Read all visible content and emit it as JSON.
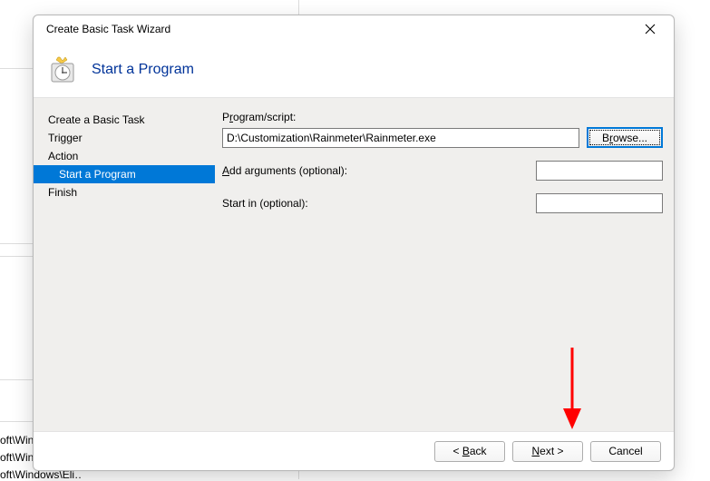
{
  "background": {
    "frag1": "oft\\Wind…",
    "frag2": "oft\\Windows\\U…",
    "frag3": "oft\\Windows\\Eli…"
  },
  "dialog": {
    "title": "Create Basic Task Wizard",
    "header": "Start a Program",
    "sidebar": {
      "items": [
        {
          "label": "Create a Basic Task"
        },
        {
          "label": "Trigger"
        },
        {
          "label": "Action"
        },
        {
          "label": "Start a Program"
        },
        {
          "label": "Finish"
        }
      ]
    },
    "form": {
      "program_label_pre": "P",
      "program_label_u": "r",
      "program_label_post": "ogram/script:",
      "program_value": "D:\\Customization\\Rainmeter\\Rainmeter.exe",
      "browse_pre": "B",
      "browse_u": "r",
      "browse_post": "owse...",
      "args_label_u": "A",
      "args_label_post": "dd arguments (optional):",
      "args_value": "",
      "startin_label": "Start in (optional):",
      "startin_value": ""
    },
    "footer": {
      "back_pre": "< ",
      "back_u": "B",
      "back_post": "ack",
      "next_u": "N",
      "next_post": "ext >",
      "cancel": "Cancel"
    }
  }
}
